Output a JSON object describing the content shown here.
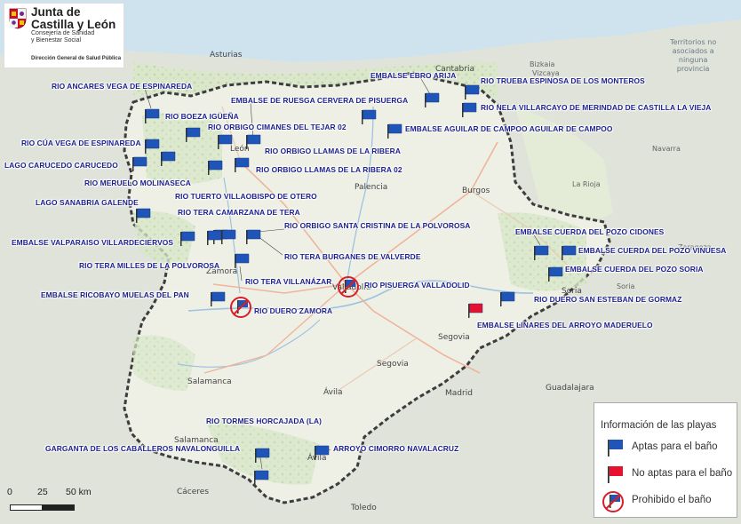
{
  "logo": {
    "line1": "Junta de",
    "line2": "Castilla y León",
    "line3": "Consejería de Sanidad",
    "line4": "y Bienestar Social",
    "line5": "Dirección General de Salud Pública"
  },
  "corner_note": {
    "line1": "Territorios no",
    "line2": "asociados a",
    "line3": "ninguna",
    "line4": "provincia"
  },
  "cities": {
    "asturias": "Asturias",
    "cantabria": "Cantabria",
    "bizkaia": "Bizkaia",
    "vizcaya": "Vizcaya",
    "leon": "León",
    "palencia": "Palencia",
    "burgos": "Burgos",
    "zamora": "Zamora",
    "valladolid": "Valladolid",
    "soria": "Soria",
    "segovia_prov": "Segovia",
    "segovia": "Segovia",
    "salamanca_prov": "Salamanca",
    "salamanca": "Salamanca",
    "avila_prov": "Ávila",
    "avila": "Ávila",
    "madrid": "Madrid",
    "guadalajara": "Guadalajara",
    "caceres": "Cáceres",
    "toledo": "Toledo",
    "la_rioja": "La Rioja",
    "navarra": "Navarra",
    "zaragoza": "Zaragoza",
    "soria_prov": "Soria"
  },
  "beaches": [
    {
      "label": "RIO ANCARES VEGA DE ESPINAREDA",
      "status": "apta"
    },
    {
      "label": "RIO BOEZA IGÜEÑA",
      "status": "apta"
    },
    {
      "label": "EMBALSE DE RUESGA CERVERA DE PISUERGA",
      "status": "apta"
    },
    {
      "label": "EMBALSE EBRO ARIJA",
      "status": "apta"
    },
    {
      "label": "RIO TRUEBA ESPINOSA DE LOS MONTEROS",
      "status": "apta"
    },
    {
      "label": "RIO NELA VILLARCAYO DE MERINDAD DE CASTILLA LA VIEJA",
      "status": "apta"
    },
    {
      "label": "RIO ORBIGO CIMANES DEL TEJAR 02",
      "status": "apta"
    },
    {
      "label": "EMBALSE AGUILAR DE CAMPOO AGUILAR DE CAMPOO",
      "status": "apta"
    },
    {
      "label": "RIO CÚA VEGA DE ESPINAREDA",
      "status": "apta"
    },
    {
      "label": "RIO ORBIGO LLAMAS DE LA RIBERA",
      "status": "apta"
    },
    {
      "label": "LAGO CARUCEDO CARUCEDO",
      "status": "apta"
    },
    {
      "label": "RIO ORBIGO LLAMAS DE LA RIBERA 02",
      "status": "apta"
    },
    {
      "label": "RIO MERUELO MOLINASECA",
      "status": "apta"
    },
    {
      "label": "RIO TUERTO VILLAOBISPO DE OTERO",
      "status": "apta"
    },
    {
      "label": "LAGO SANABRIA GALENDE",
      "status": "apta"
    },
    {
      "label": "RIO TERA CAMARZANA DE TERA",
      "status": "apta"
    },
    {
      "label": "RIO ORBIGO SANTA CRISTINA DE LA POLVOROSA",
      "status": "apta"
    },
    {
      "label": "EMBALSE CUERDA DEL POZO CIDONES",
      "status": "apta"
    },
    {
      "label": "EMBALSE VALPARAISO VILLARDECIERVOS",
      "status": "apta"
    },
    {
      "label": "EMBALSE CUERDA DEL POZO VINUESA",
      "status": "apta"
    },
    {
      "label": "RIO TERA BURGANES DE VALVERDE",
      "status": "apta"
    },
    {
      "label": "EMBALSE CUERDA DEL POZO SORIA",
      "status": "apta"
    },
    {
      "label": "RIO TERA MILLES DE LA POLVOROSA",
      "status": "apta"
    },
    {
      "label": "RIO TERA VILLANÁZAR",
      "status": "apta"
    },
    {
      "label": "RIO PISUERGA VALLADOLID",
      "status": "prohibido"
    },
    {
      "label": "EMBALSE RICOBAYO MUELAS DEL PAN",
      "status": "apta"
    },
    {
      "label": "RIO DUERO SAN ESTEBAN DE GORMAZ",
      "status": "apta"
    },
    {
      "label": "RIO DUERO ZAMORA",
      "status": "prohibido"
    },
    {
      "label": "EMBALSE LINARES DEL ARROYO MADERUELO",
      "status": "no_apta"
    },
    {
      "label": "RIO TORMES HORCAJADA (LA)",
      "status": "apta"
    },
    {
      "label": "GARGANTA DE LOS CABALLEROS NAVALONGUILLA",
      "status": "apta"
    },
    {
      "label": "ARROYO CIMORRO NAVALACRUZ",
      "status": "apta"
    }
  ],
  "legend": {
    "title": "Información de las playas",
    "items": [
      {
        "label": "Aptas para el baño",
        "status": "apta"
      },
      {
        "label": "No aptas para el baño",
        "status": "no_apta"
      },
      {
        "label": "Prohibido el baño",
        "status": "prohibido"
      }
    ]
  },
  "scale": {
    "ticks": [
      "0",
      "25",
      "50 km"
    ]
  },
  "colors": {
    "flag_apta": "#1f55b8",
    "flag_no_apta": "#e8112d",
    "prohibited_ring": "#d81e2a",
    "label_text": "#1b1f8c",
    "region_fill": "#eef0e6",
    "outside_fill": "#dfe3da",
    "sea": "#cfe3ef",
    "border": "#3d3d3d"
  }
}
